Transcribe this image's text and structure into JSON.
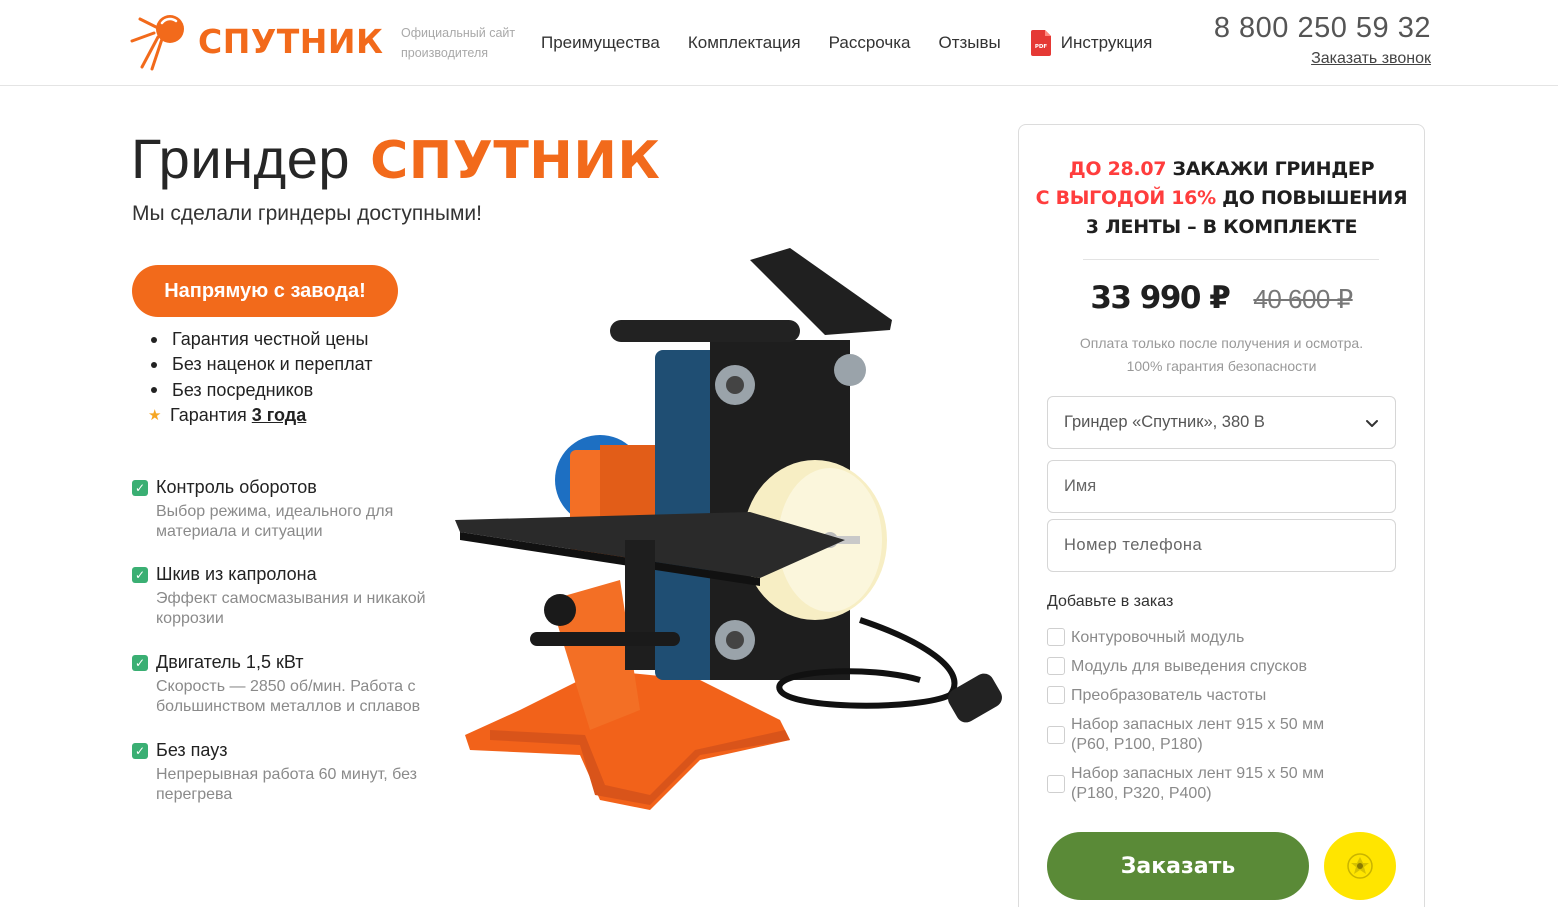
{
  "header": {
    "brand": "СПУТНИК",
    "brand_sub": "Официальный сайт производителя",
    "nav": [
      "Преимущества",
      "Комплектация",
      "Рассрочка",
      "Отзывы",
      "Инструкция"
    ],
    "pdf_badge": "PDF",
    "phone": "8 800 250 59 32",
    "callback": "Заказать звонок"
  },
  "hero": {
    "title_plain": "Гриндер",
    "title_brand": "СПУТНИК",
    "subtitle": "Мы сделали гриндеры доступными!",
    "pill": "Напрямую с завода!",
    "bullets": [
      "Гарантия честной цены",
      "Без наценок и переплат",
      "Без посредников"
    ],
    "warranty_prefix": "Гарантия",
    "warranty_term": "3 года"
  },
  "features": [
    {
      "title": "Контроль оборотов",
      "desc": "Выбор режима, идеального для материала и ситуации"
    },
    {
      "title": "Шкив из капролона",
      "desc": "Эффект самосмазывания и никакой коррозии"
    },
    {
      "title": "Двигатель 1,5 кВт",
      "desc": "Скорость — 2850 об/мин. Работа с большинством металлов и сплавов"
    },
    {
      "title": "Без пауз",
      "desc": "Непрерывная работа 60 минут, без перегрева"
    }
  ],
  "order": {
    "promo_date": "ДО 28.07",
    "promo_line1_rest": "ЗАКАЖИ ГРИНДЕР",
    "promo_discount": "С ВЫГОДОЙ 16%",
    "promo_line2_rest": "ДО ПОВЫШЕНИЯ",
    "promo_line3": "3 ЛЕНТЫ – В КОМПЛЕКТЕ",
    "price_now": "33 990 ₽",
    "price_old": "40 600 ₽",
    "pay_note_1": "Оплата только после получения и осмотра.",
    "pay_note_2": "100% гарантия безопасности",
    "model_selected": "Гриндер «Спутник», 380 В",
    "name_placeholder": "Имя",
    "phone_placeholder": "Номер телефона",
    "addons_title": "Добавьте в заказ",
    "addons": [
      "Контуровочный модуль",
      "Модуль для выведения спусков",
      "Преобразователь частоты",
      "Набор запасных лент 915 х 50 мм (Р60, Р100, Р180)",
      "Набор запасных лент 915 х 50 мм (Р180, Р320, Р400)"
    ],
    "submit": "Заказать"
  },
  "colors": {
    "brand_orange": "#f26a1b",
    "promo_red": "#ff3d3d",
    "check_green": "#3aaf73",
    "order_green": "#5a8a37",
    "bank_yellow": "#ffe500"
  }
}
